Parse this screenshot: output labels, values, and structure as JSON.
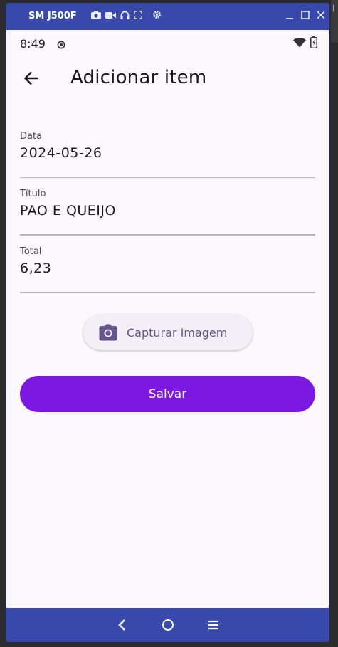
{
  "window": {
    "device_name": "SM J500F"
  },
  "status_bar": {
    "time": "8:49"
  },
  "app_bar": {
    "title": "Adicionar item"
  },
  "form": {
    "fields": [
      {
        "label": "Data",
        "value": "2024-05-26"
      },
      {
        "label": "Título",
        "value": "PAO E QUEIJO"
      },
      {
        "label": "Total",
        "value": "6,23"
      }
    ]
  },
  "actions": {
    "capture_label": "Capturar Imagem",
    "save_label": "Salvar"
  },
  "colors": {
    "window_frame": "#3949ab",
    "background": "#fdf8fd",
    "primary": "#7b19e3",
    "capture_text": "#65558f"
  }
}
